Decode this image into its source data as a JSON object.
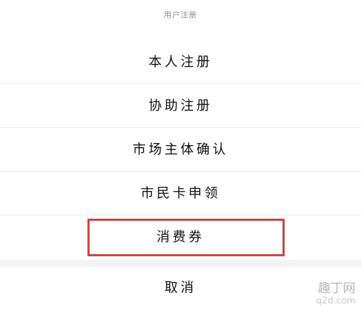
{
  "sheet": {
    "title": "用户注册",
    "items": [
      {
        "label": "本人注册"
      },
      {
        "label": "协助注册"
      },
      {
        "label": "市场主体确认"
      },
      {
        "label": "市民卡申领"
      },
      {
        "label": "消费券",
        "highlighted": true
      }
    ],
    "cancel_label": "取消"
  },
  "watermark": {
    "main": "趣丁网",
    "sub": "q2d.com"
  },
  "colors": {
    "highlight": "#e23b3b",
    "divider": "#ececec",
    "gap": "#f3f3f3"
  }
}
